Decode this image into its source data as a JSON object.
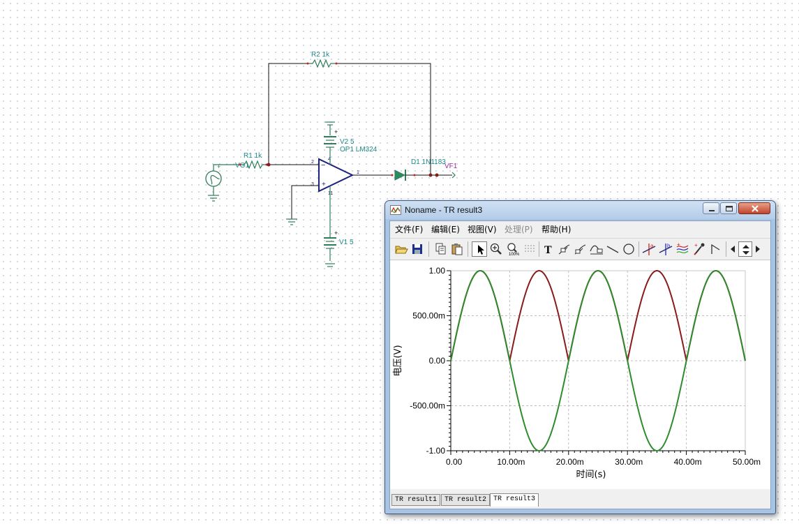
{
  "schematic": {
    "labels": {
      "r2": "R2 1k",
      "r1": "R1 1k",
      "vg1": "VG1",
      "v2": "V2 5",
      "op1": "OP1 LM324",
      "d1": "D1 1N1183",
      "vf1": "VF1",
      "v1": "V1 5"
    },
    "pins": {
      "inv": "2",
      "noninv": "3",
      "out": "1",
      "vplus": "4",
      "vminus": "11"
    }
  },
  "window": {
    "title": "Noname - TR result3",
    "menu": [
      {
        "label": "文件(F)",
        "disabled": false
      },
      {
        "label": "编辑(E)",
        "disabled": false
      },
      {
        "label": "视图(V)",
        "disabled": false
      },
      {
        "label": "处理(P)",
        "disabled": true
      },
      {
        "label": "帮助(H)",
        "disabled": false
      }
    ],
    "toolbar": {
      "icons": [
        "open-folder-icon",
        "save-icon",
        "copy-icon",
        "paste-icon",
        "pointer-icon",
        "zoom-in-icon",
        "zoom-100-icon",
        "grid-icon",
        "text-icon",
        "curve-label-icon",
        "curve-label2-icon",
        "curve-label3-icon",
        "line-icon",
        "circle-icon",
        "cursor-a-icon",
        "cursor-b-icon",
        "waveform-icon",
        "probe-icon",
        "flag-icon",
        "scroll-left-icon",
        "scroll-updown-icon",
        "scroll-right-icon"
      ],
      "text_tool": "T"
    },
    "tabs": [
      "TR result1",
      "TR result2",
      "TR result3"
    ],
    "active_tab": 2
  },
  "chart_data": {
    "type": "line",
    "xlabel": "时间(s)",
    "ylabel": "电压(V)",
    "xlim": [
      0,
      0.05
    ],
    "ylim": [
      -1,
      1
    ],
    "x_ticks": [
      0,
      0.01,
      0.02,
      0.03,
      0.04,
      0.05
    ],
    "x_tick_labels": [
      "0.00",
      "10.00m",
      "20.00m",
      "30.00m",
      "40.00m",
      "50.00m"
    ],
    "y_ticks": [
      1,
      0.5,
      0,
      -0.5,
      -1
    ],
    "y_tick_labels": [
      "1.00",
      "500.00m",
      "0.00",
      "-500.00m",
      "-1.00"
    ],
    "grid": true,
    "series": [
      {
        "color": "#8b1a1a",
        "function": "abs(sin(2*pi*50*t))",
        "amplitude": 1.0,
        "frequency_hz": 50
      },
      {
        "color": "#2e8b2e",
        "function": "sin(2*pi*50*t)",
        "amplitude": 1.0,
        "frequency_hz": 50
      }
    ]
  },
  "colors": {
    "wire": "#111111",
    "component": "#2e7d5a",
    "opamp": "#1a237e",
    "label": "#1c8a8a",
    "probe": "#9a2a9a"
  }
}
